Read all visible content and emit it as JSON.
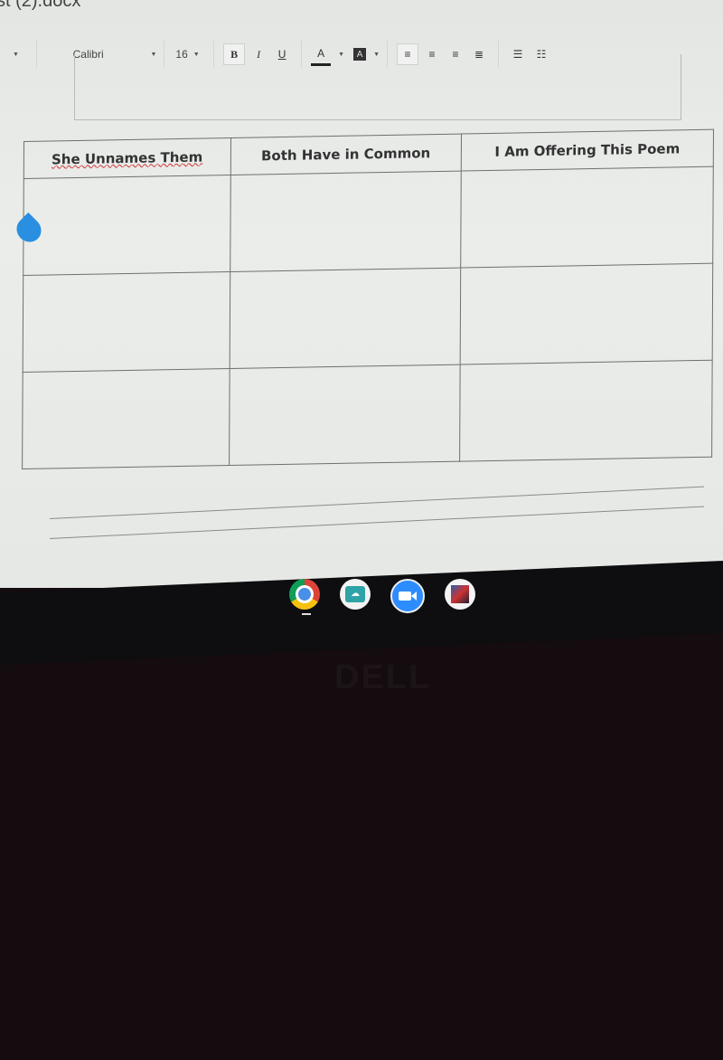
{
  "document": {
    "title_fragment": "st (2).docx"
  },
  "toolbar": {
    "font_family": "Calibri",
    "font_size": "16",
    "bold": "B",
    "italic": "I",
    "underline": "U",
    "text_color": "A",
    "highlight": "A"
  },
  "table": {
    "headers": [
      "She Unnames Them",
      "Both Have in Common",
      "I Am Offering This Poem"
    ],
    "rows": [
      [
        "",
        "",
        ""
      ],
      [
        "",
        "",
        ""
      ],
      [
        "",
        "",
        ""
      ]
    ]
  },
  "dock": {
    "apps": [
      "chrome-icon",
      "cloud-app-icon",
      "zoom-icon",
      "game-app-icon"
    ]
  },
  "bezel": {
    "brand": "DELL"
  },
  "colors": {
    "accent": "#2a8fe0",
    "zoom": "#2d8cff"
  }
}
